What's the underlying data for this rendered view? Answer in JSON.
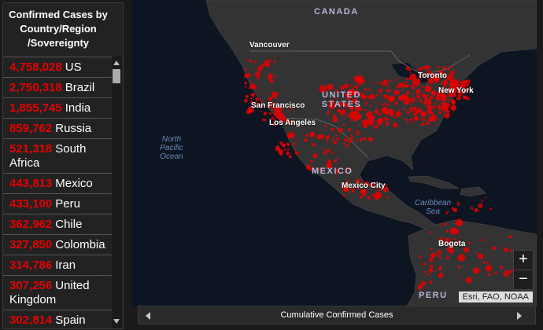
{
  "sidebar": {
    "title": "Confirmed Cases by Country/Region /Sovereignty",
    "items": [
      {
        "count": "4,758,028",
        "name": "US"
      },
      {
        "count": "2,750,318",
        "name": "Brazil"
      },
      {
        "count": "1,855,745",
        "name": "India"
      },
      {
        "count": "859,762",
        "name": "Russia"
      },
      {
        "count": "521,318",
        "name": "South Africa"
      },
      {
        "count": "443,813",
        "name": "Mexico"
      },
      {
        "count": "433,100",
        "name": "Peru"
      },
      {
        "count": "362,962",
        "name": "Chile"
      },
      {
        "count": "327,850",
        "name": "Colombia"
      },
      {
        "count": "314,786",
        "name": "Iran"
      },
      {
        "count": "307,256",
        "name": "United Kingdom"
      },
      {
        "count": "302,814",
        "name": "Spain"
      }
    ]
  },
  "map": {
    "labels": {
      "canada": "CANADA",
      "united_states": "UNITED STATES",
      "mexico": "MEXICO",
      "peru": "PERU",
      "north_pacific_ocean": "North Pacific Ocean",
      "caribbean_sea": "Caribbean Sea",
      "vancouver": "Vancouver",
      "toronto": "Toronto",
      "new_york": "New York",
      "san_francisco": "San Francisco",
      "los_angeles": "Los Angeles",
      "mexico_city": "Mexico City",
      "bogota": "Bogota"
    },
    "zoom_in": "+",
    "zoom_out": "−",
    "attribution": "Esri, FAO, NOAA",
    "colors": {
      "ocean": "#0d1522",
      "land": "#333333",
      "case_dot": "#e60000"
    }
  },
  "footer": {
    "label": "Cumulative Confirmed Cases"
  }
}
